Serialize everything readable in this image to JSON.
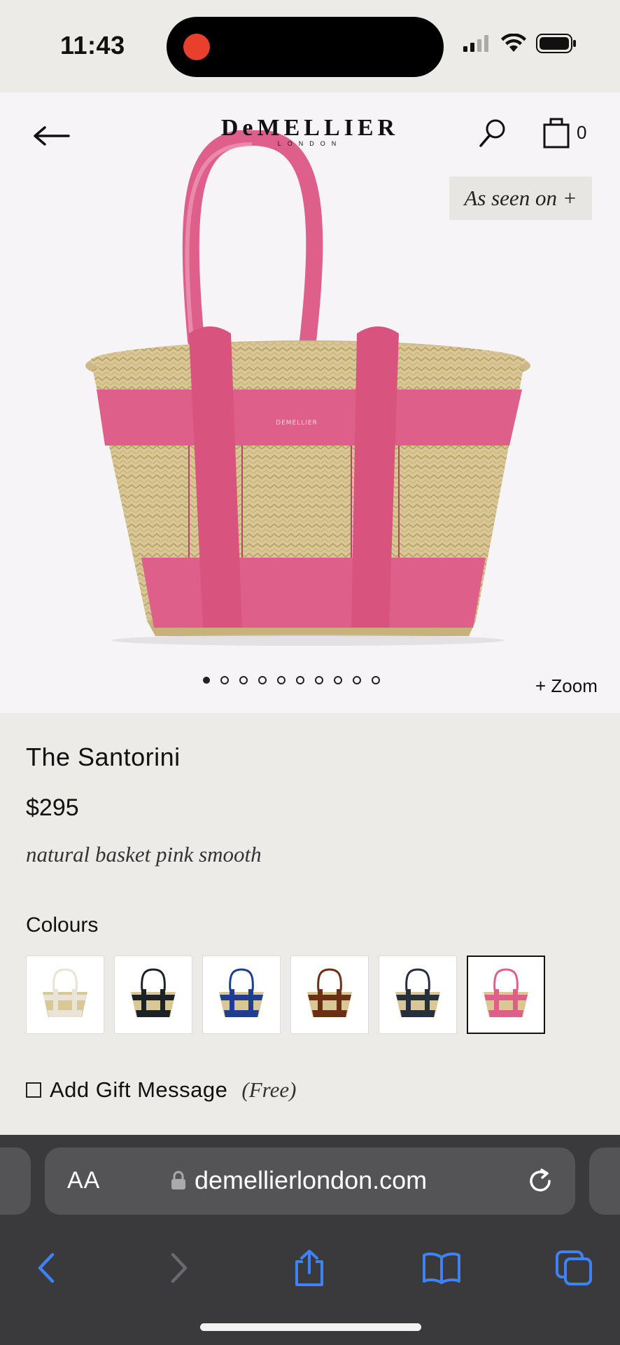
{
  "status_bar": {
    "time": "11:43"
  },
  "header": {
    "logo_main": "DeMELLIER",
    "logo_sub": "LONDON",
    "cart_count": "0",
    "icons": {
      "back": "arrow-left-icon",
      "search": "search-icon",
      "cart": "shopping-bag-icon"
    }
  },
  "gallery": {
    "as_seen_on": "As seen on +",
    "zoom": "+ Zoom",
    "image_count": 10,
    "active_index": 0
  },
  "product": {
    "title": "The Santorini",
    "price": "$295",
    "variant": "natural basket pink smooth",
    "colours_label": "Colours",
    "swatches": [
      {
        "name": "ecru",
        "strap_color": "#e9e4d8",
        "selected": false
      },
      {
        "name": "black",
        "strap_color": "#1d2128",
        "selected": false
      },
      {
        "name": "blue",
        "strap_color": "#1f3d92",
        "selected": false
      },
      {
        "name": "brown",
        "strap_color": "#6b2f15",
        "selected": false
      },
      {
        "name": "navy",
        "strap_color": "#26303d",
        "selected": false
      },
      {
        "name": "pink",
        "strap_color": "#de5f8a",
        "selected": true
      }
    ],
    "gift_message_label": "Add Gift Message",
    "gift_message_note": "(Free)"
  },
  "browser": {
    "aa_label": "AA",
    "url": "demellierlondon.com",
    "accent_color": "#3d82f6"
  },
  "colors": {
    "page_bg": "#edebe8",
    "hero_bg": "#f6f4f7",
    "bag_pink": "#de5f8a",
    "straw": "#d9c796"
  }
}
